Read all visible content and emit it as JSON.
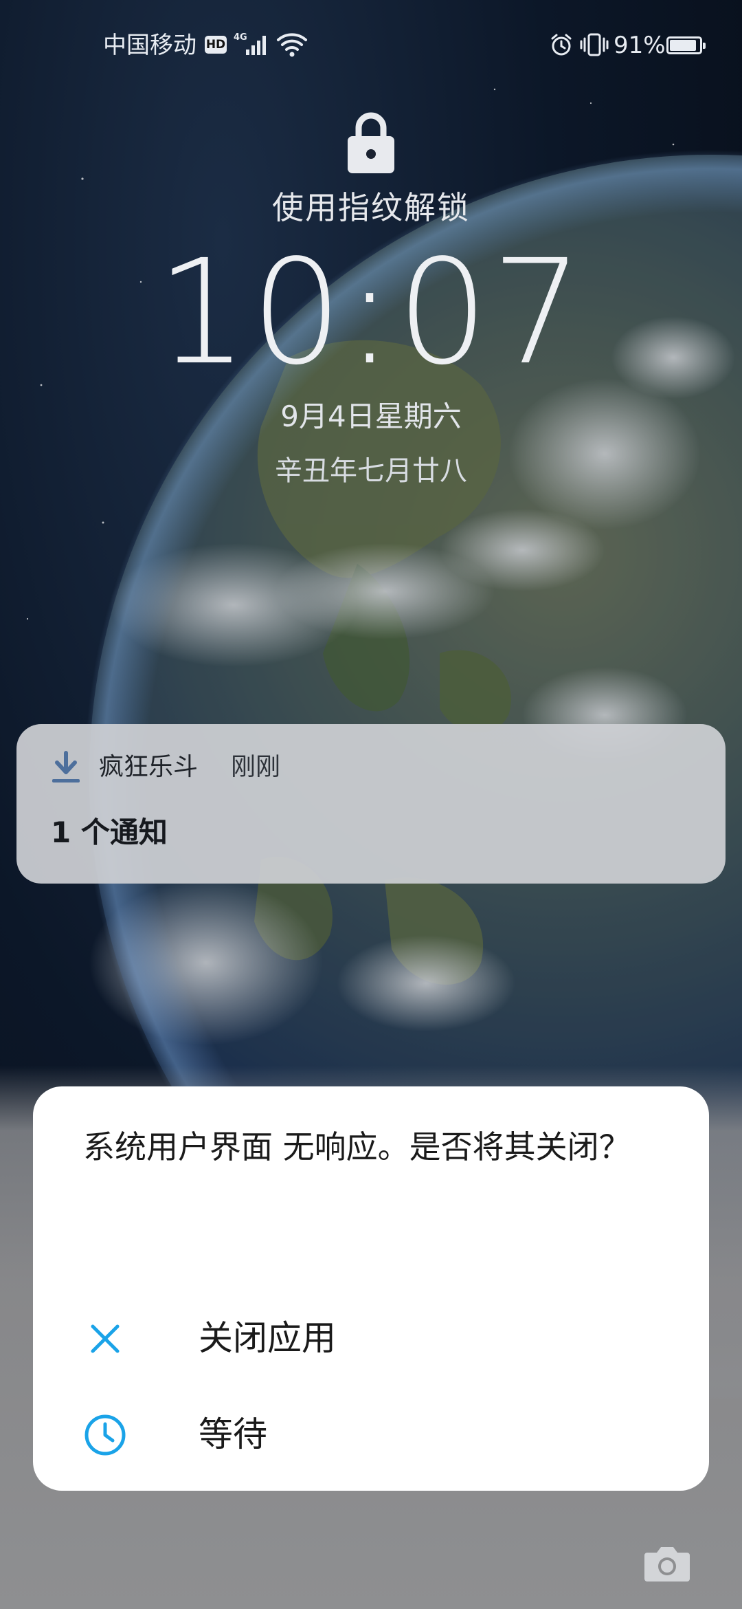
{
  "status_bar": {
    "carrier": "中国移动",
    "hd_badge": "HD",
    "network_type": "4G",
    "battery_percent": "91%",
    "battery_level": 0.91,
    "icons": [
      "hd-badge-icon",
      "cellular-signal-icon",
      "wifi-icon",
      "alarm-icon",
      "vibrate-icon",
      "battery-icon"
    ]
  },
  "lock_screen": {
    "unlock_hint": "使用指纹解锁",
    "time": "10:07",
    "date": "9月4日星期六",
    "lunar_date": "辛丑年七月廿八",
    "icons": [
      "lock-icon",
      "camera-icon"
    ]
  },
  "notification": {
    "app_name": "疯狂乐斗",
    "time": "刚刚",
    "summary": "1 个通知",
    "app_icon": "download-icon"
  },
  "dialog": {
    "message": "系统用户界面 无响应。是否将其关闭？",
    "options": [
      {
        "label": "关闭应用",
        "icon": "close-icon"
      },
      {
        "label": "等待",
        "icon": "clock-icon"
      }
    ],
    "accent_color": "#1aa3e8"
  }
}
